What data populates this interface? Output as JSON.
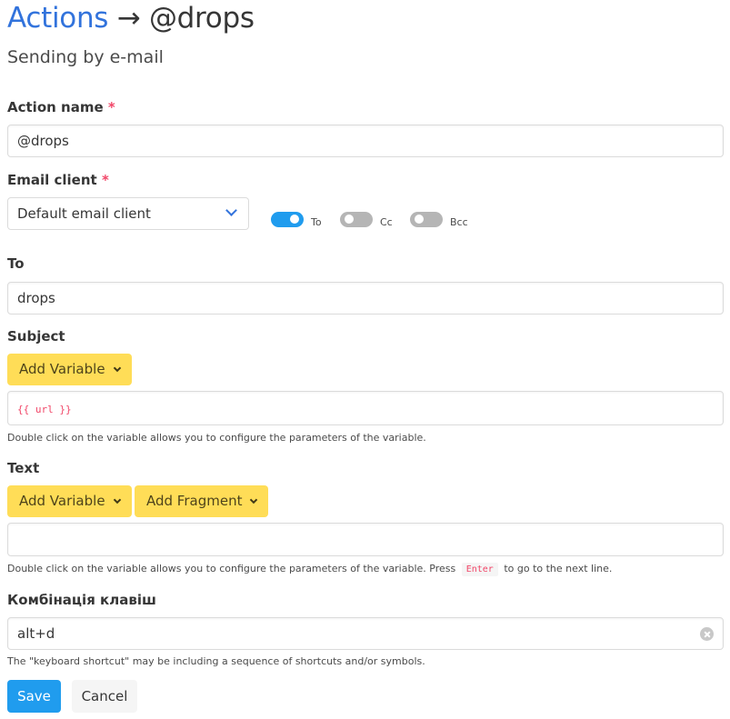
{
  "header": {
    "breadcrumb_link": "Actions",
    "separator": "→",
    "action_title": "@drops",
    "subtitle": "Sending by e-mail"
  },
  "form": {
    "action_name": {
      "label": "Action name",
      "required_mark": "*",
      "value": "@drops"
    },
    "email_client": {
      "label": "Email client",
      "required_mark": "*",
      "selected": "Default email client",
      "toggles": [
        {
          "label": "To",
          "on": true
        },
        {
          "label": "Cc",
          "on": false
        },
        {
          "label": "Bcc",
          "on": false
        }
      ]
    },
    "to": {
      "label": "To",
      "value": "drops"
    },
    "subject": {
      "label": "Subject",
      "add_variable_label": "Add Variable",
      "value": "{{ url }}",
      "help": "Double click on the variable allows you to configure the parameters of the variable."
    },
    "text": {
      "label": "Text",
      "add_variable_label": "Add Variable",
      "add_fragment_label": "Add Fragment",
      "value": "",
      "help_before": "Double click on the variable allows you to configure the parameters of the variable. Press",
      "help_key": "Enter",
      "help_after": "to go to the next line."
    },
    "shortcut": {
      "label": "Комбінація клавіш",
      "value": "alt+d",
      "help": "The \"keyboard shortcut\" may be including a sequence of shortcuts and/or symbols."
    }
  },
  "actions": {
    "save_label": "Save",
    "cancel_label": "Cancel"
  },
  "colors": {
    "link": "#3273dc",
    "primary": "#209cee",
    "warning": "#ffdd57",
    "danger": "#f14668"
  }
}
